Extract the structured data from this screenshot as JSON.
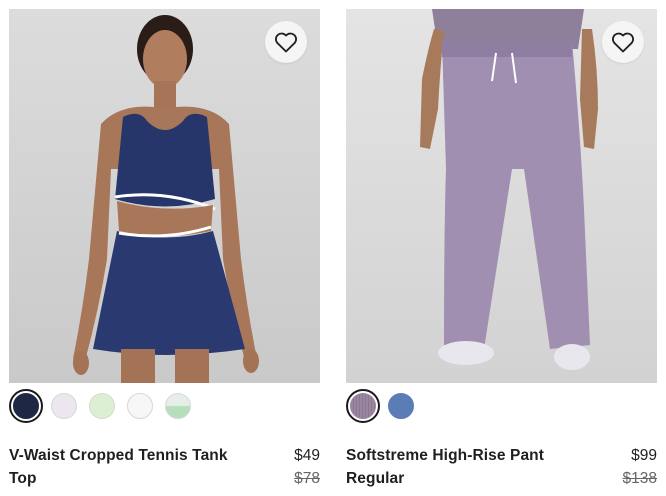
{
  "products": [
    {
      "name": "V-Waist Cropped Tennis Tank Top",
      "price": "$49",
      "original_price": "$78",
      "favorite_icon": "heart-outline-icon",
      "swatches": [
        {
          "color": "#1e2844",
          "selected": true
        },
        {
          "color": "#ece6ef",
          "selected": false
        },
        {
          "color": "#dcefd2",
          "selected": false
        },
        {
          "color": "#f7f7f7",
          "selected": false
        },
        {
          "color": "#bfe0c3",
          "selected": false
        }
      ]
    },
    {
      "name": "Softstreme High-Rise Pant Regular",
      "price": "$99",
      "original_price": "$138",
      "favorite_icon": "heart-outline-icon",
      "swatches": [
        {
          "color": "#9a86a0",
          "selected": true
        },
        {
          "color": "#5b7db5",
          "selected": false
        }
      ]
    }
  ]
}
